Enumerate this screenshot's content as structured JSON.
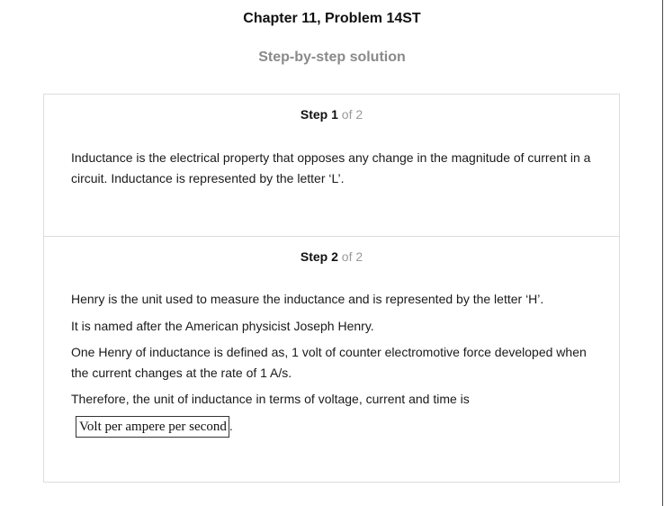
{
  "header": {
    "title": "Chapter 11, Problem 14ST",
    "subtitle": "Step-by-step solution"
  },
  "steps": [
    {
      "label": "Step",
      "number": "1",
      "of_text": "of 2",
      "paragraphs": [
        "Inductance is the electrical property that opposes any change in the magnitude of current in a circuit. Inductance is represented by the letter ‘L’."
      ]
    },
    {
      "label": "Step",
      "number": "2",
      "of_text": "of 2",
      "paragraphs": [
        "Henry is the unit used to measure the inductance and is represented by the letter ‘H’.",
        "It is named after the American physicist Joseph Henry.",
        "One Henry of inductance is defined as, 1 volt of counter electromotive force developed when the current changes at the rate of 1 A/s.",
        "Therefore, the unit of inductance in terms of voltage, current and time is"
      ],
      "answer": "Volt per ampere per second",
      "answer_suffix": "."
    }
  ]
}
